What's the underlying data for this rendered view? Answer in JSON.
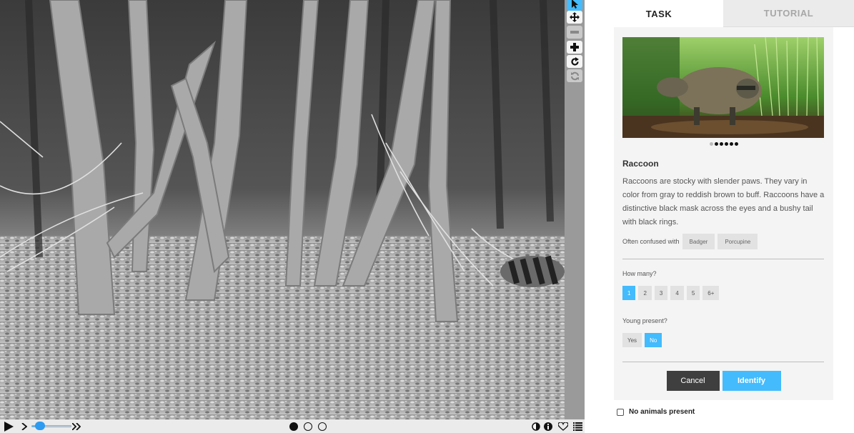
{
  "tabs": {
    "task": "TASK",
    "tutorial": "TUTORIAL"
  },
  "toolbar": {
    "tools": [
      {
        "name": "pointer",
        "icon": "arrow-cursor-icon",
        "state": "active"
      },
      {
        "name": "move",
        "icon": "move-arrows-icon",
        "state": "enabled"
      },
      {
        "name": "zoom-out",
        "icon": "minus-icon",
        "state": "disabled"
      },
      {
        "name": "zoom-in",
        "icon": "plus-icon",
        "state": "enabled"
      },
      {
        "name": "rotate",
        "icon": "rotate-icon",
        "state": "enabled"
      },
      {
        "name": "reset",
        "icon": "refresh-icon",
        "state": "disabled"
      }
    ]
  },
  "player": {
    "play_icon": "play-icon",
    "step_icon": "chevron-right-icon",
    "fast_icon": "fast-forward-icon",
    "speed_level": 0.2,
    "frames": 3,
    "current_frame": 1,
    "right_icons": [
      "contrast-icon",
      "info-icon",
      "heart-icon",
      "list-icon"
    ]
  },
  "species": {
    "name": "Raccoon",
    "description": "Raccoons are stocky with slender paws. They vary in color from gray to reddish brown to buff. Raccoons have a distinctive black mask across the eyes and a bushy tail with black rings.",
    "confused_label": "Often confused with",
    "confused_with": [
      "Badger",
      "Porcupine"
    ],
    "photo_count": 6,
    "photo_current": 1
  },
  "questions": {
    "how_many": {
      "label": "How many?",
      "options": [
        "1",
        "2",
        "3",
        "4",
        "5",
        "6+"
      ],
      "selected": "1"
    },
    "young": {
      "label": "Young present?",
      "options": [
        "Yes",
        "No"
      ],
      "selected": "No"
    }
  },
  "buttons": {
    "cancel": "Cancel",
    "identify": "Identify"
  },
  "no_animals": {
    "label": "No animals present",
    "checked": false
  },
  "colors": {
    "accent": "#43bbfd",
    "dark_button": "#3f3f3f",
    "card_bg": "#f4f4f4"
  }
}
